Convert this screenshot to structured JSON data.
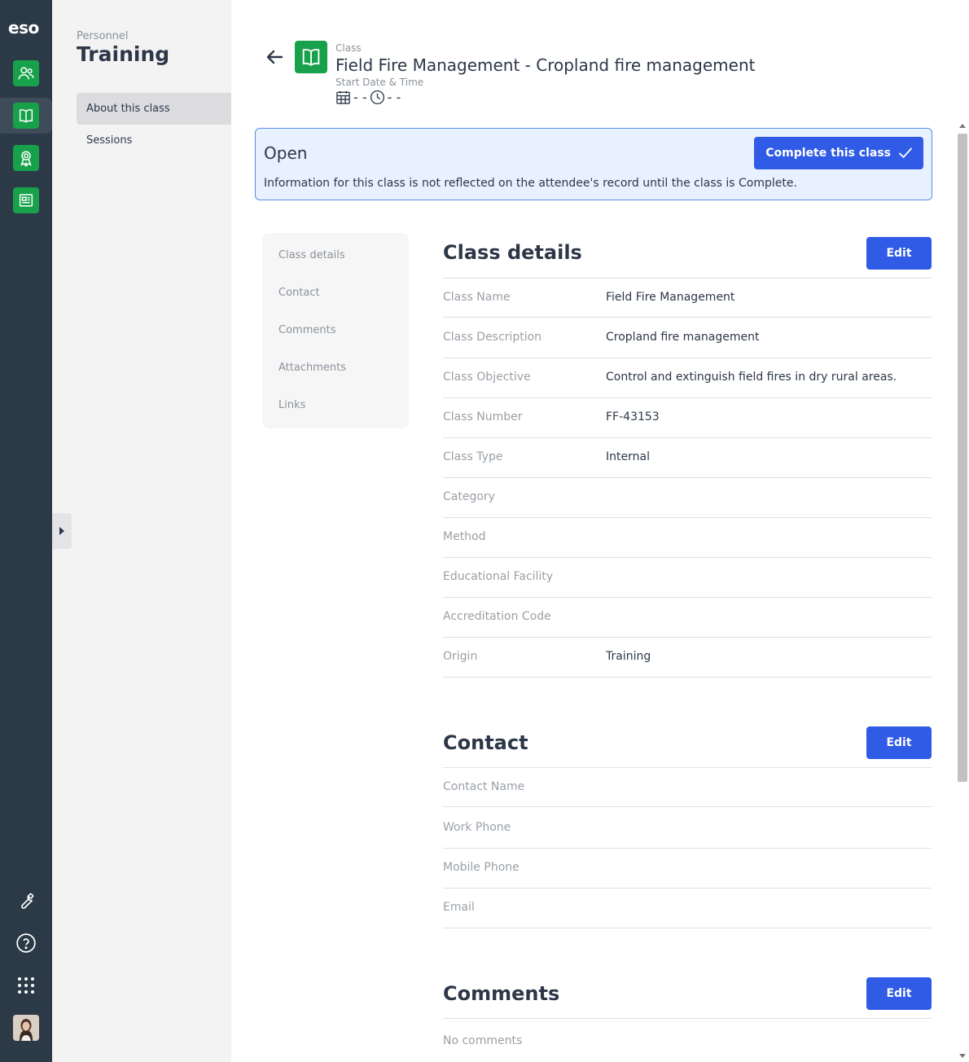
{
  "app": {
    "logo": "eso"
  },
  "rail": {
    "items": [
      {
        "icon": "people-icon"
      },
      {
        "icon": "book-icon"
      },
      {
        "icon": "award-icon"
      },
      {
        "icon": "newspaper-icon"
      }
    ],
    "bottom": [
      {
        "icon": "wrench-icon"
      },
      {
        "icon": "help-icon"
      },
      {
        "icon": "apps-grid-icon"
      }
    ]
  },
  "subnav": {
    "crumb": "Personnel",
    "title": "Training",
    "items": [
      {
        "label": "About this class",
        "active": true
      },
      {
        "label": "Sessions",
        "active": false
      }
    ]
  },
  "header": {
    "label": "Class",
    "title": "Field Fire Management - Cropland fire management",
    "sub_label": "Start Date & Time",
    "date_value": "- -",
    "time_value": "- -"
  },
  "banner": {
    "status": "Open",
    "message": "Information for this class is not reflected on the attendee's record until the class is Complete.",
    "button_label": "Complete this class"
  },
  "pagenav": {
    "items": [
      "Class details",
      "Contact",
      "Comments",
      "Attachments",
      "Links"
    ]
  },
  "class_details": {
    "title": "Class details",
    "edit_label": "Edit",
    "fields": [
      {
        "label": "Class Name",
        "value": "Field Fire Management"
      },
      {
        "label": "Class Description",
        "value": "Cropland fire management"
      },
      {
        "label": "Class Objective",
        "value": "Control and extinguish field fires in dry rural areas."
      },
      {
        "label": "Class Number",
        "value": "FF-43153"
      },
      {
        "label": "Class Type",
        "value": "Internal"
      },
      {
        "label": "Category",
        "value": ""
      },
      {
        "label": "Method",
        "value": ""
      },
      {
        "label": "Educational Facility",
        "value": ""
      },
      {
        "label": "Accreditation Code",
        "value": ""
      },
      {
        "label": "Origin",
        "value": "Training"
      }
    ]
  },
  "contact": {
    "title": "Contact",
    "edit_label": "Edit",
    "fields": [
      {
        "label": "Contact Name",
        "value": ""
      },
      {
        "label": "Work Phone",
        "value": ""
      },
      {
        "label": "Mobile Phone",
        "value": ""
      },
      {
        "label": "Email",
        "value": ""
      }
    ]
  },
  "comments": {
    "title": "Comments",
    "edit_label": "Edit",
    "empty_text": "No comments"
  },
  "colors": {
    "rail_bg": "#2c3a47",
    "accent_green": "#18a14b",
    "primary_blue": "#2f5be6",
    "banner_bg": "#e8f1ff"
  }
}
